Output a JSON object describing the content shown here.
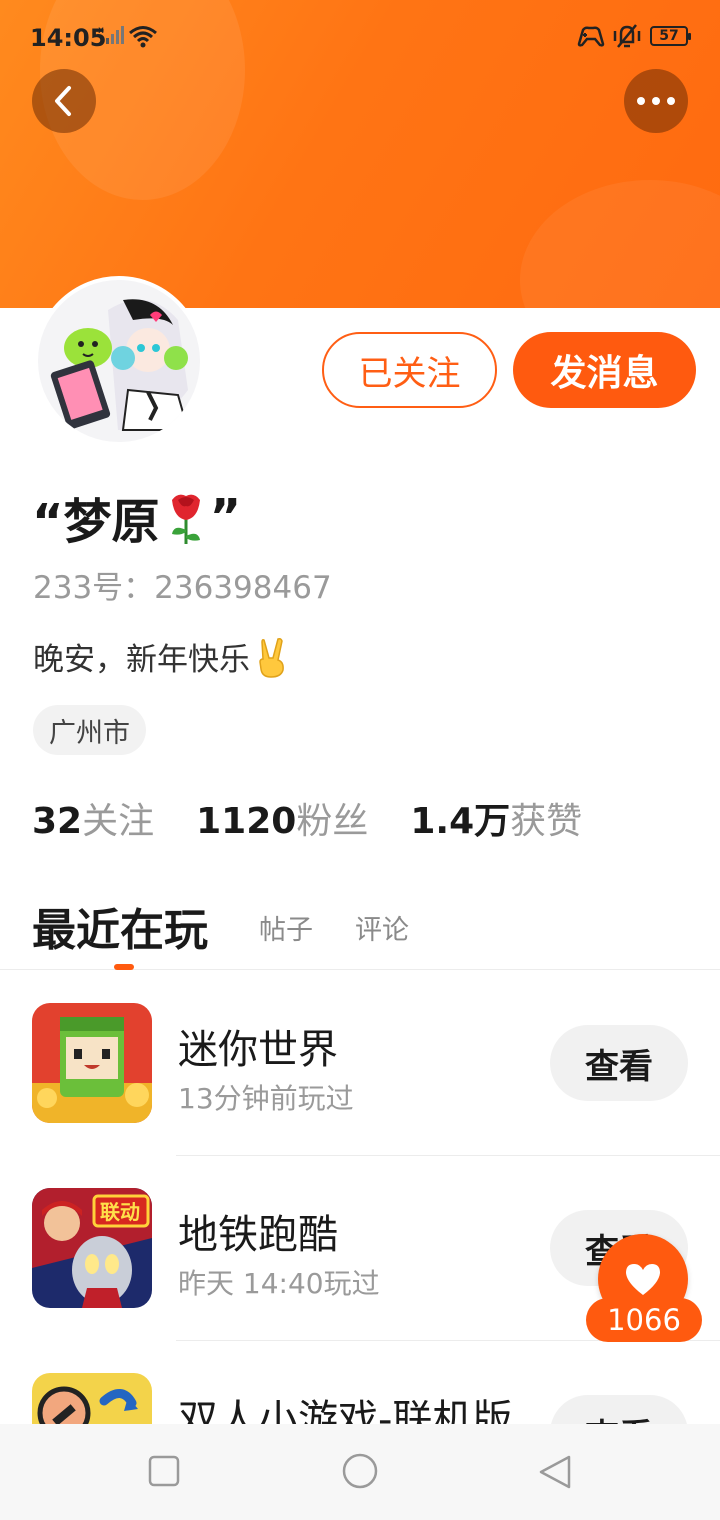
{
  "status_bar": {
    "time": "14:05",
    "battery": "57"
  },
  "profile": {
    "nickname": "“梦原",
    "nickname_suffix": "”",
    "account_id": "233号：236398467",
    "bio": "晚安，新年快乐",
    "city": "广州市",
    "actions": {
      "followed_label": "已关注",
      "message_label": "发消息"
    },
    "stats": [
      {
        "value": "32",
        "label": "关注"
      },
      {
        "value": "1120",
        "label": "粉丝"
      },
      {
        "value": "1.4万",
        "label": "获赞"
      }
    ]
  },
  "tabs": {
    "active": "最近在玩",
    "posts": "帖子",
    "comments": "评论"
  },
  "games": [
    {
      "name": "迷你世界",
      "played": "13分钟前玩过",
      "button": "查看"
    },
    {
      "name": "地铁跑酷",
      "played": "昨天 14:40玩过",
      "button": "查看"
    },
    {
      "name": "双人小游戏-联机版",
      "played": "",
      "button": "查看"
    }
  ],
  "like_badge": {
    "count": "1066"
  },
  "colors": {
    "accent": "#ff5a0f",
    "banner": "#ff7414"
  }
}
